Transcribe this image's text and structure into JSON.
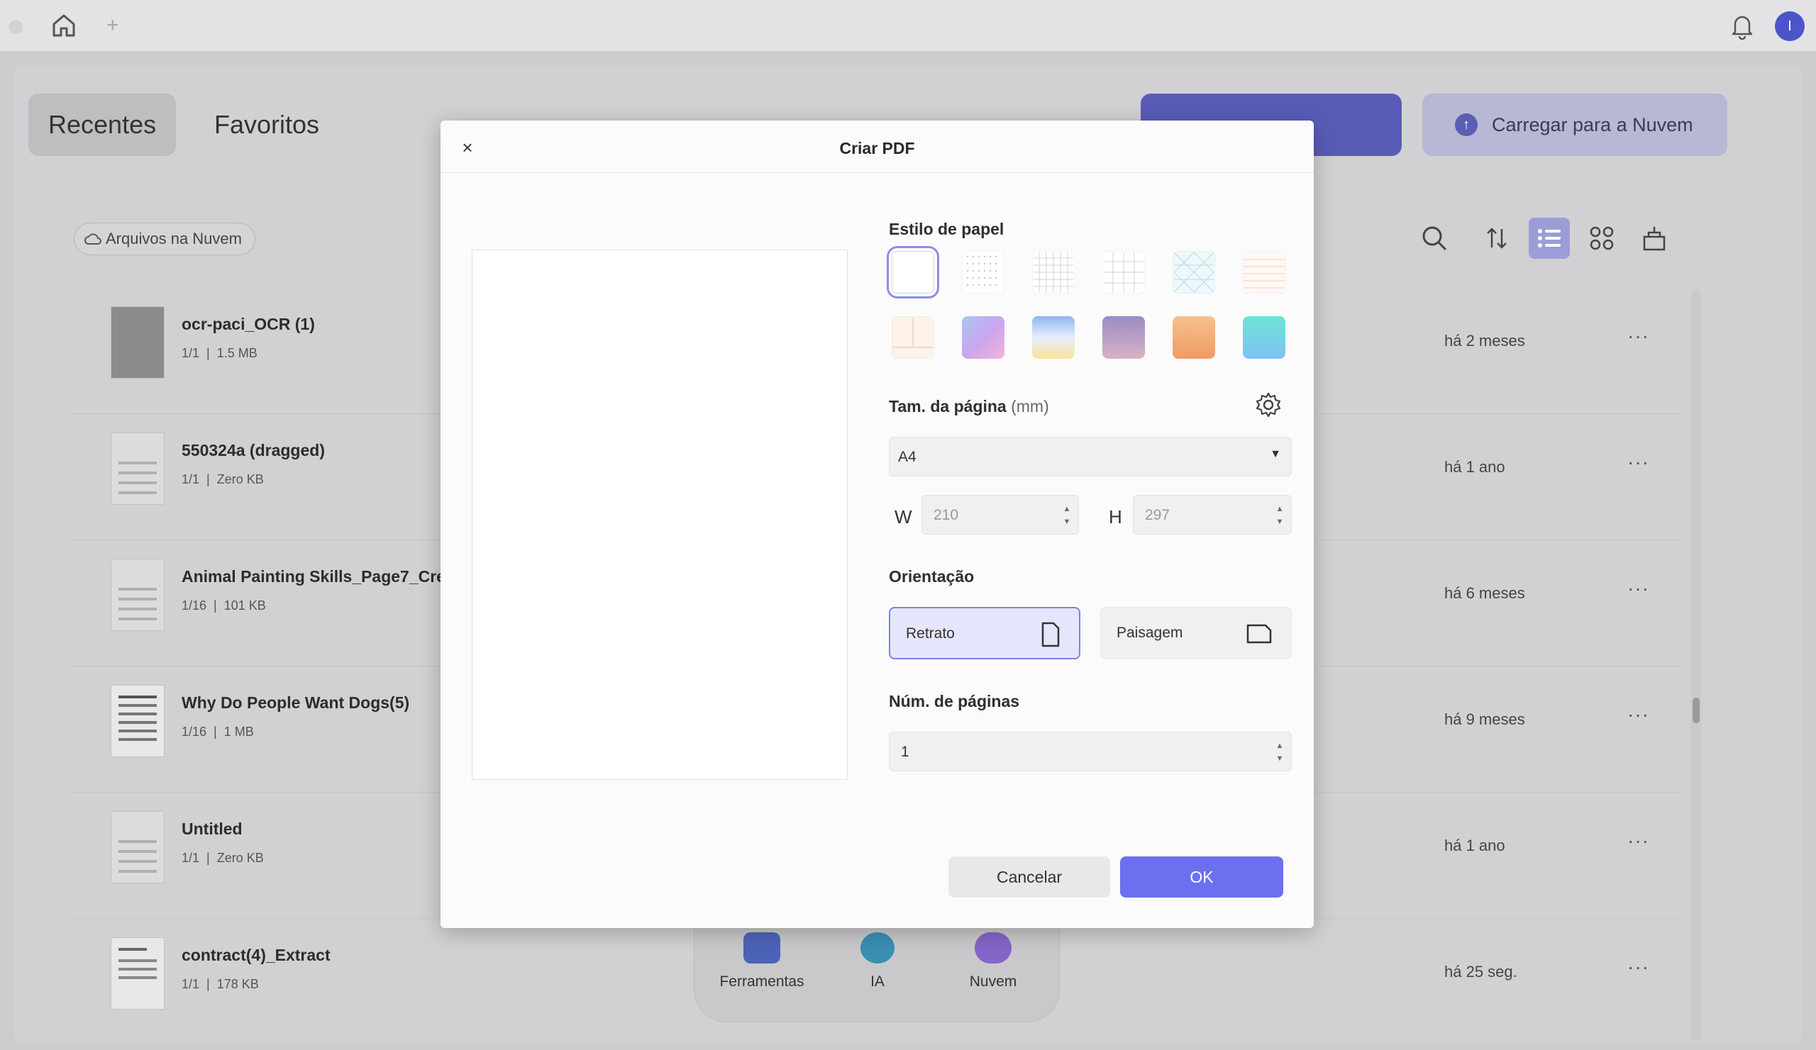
{
  "topbar": {
    "avatar_initial": "I"
  },
  "tabs": [
    {
      "label": "Recentes"
    },
    {
      "label": "Favoritos"
    }
  ],
  "header_buttons": {
    "upload_label": "Carregar para a Nuvem"
  },
  "cloud_filter": {
    "label": "Arquivos na Nuvem"
  },
  "files": [
    {
      "name": "ocr-paci_OCR (1)",
      "pages": "1/1",
      "size": "1.5 MB",
      "time": "há 2 meses"
    },
    {
      "name": "550324a (dragged)",
      "pages": "1/1",
      "size": "Zero KB",
      "time": "há 1 ano"
    },
    {
      "name": "Animal Painting Skills_Page7_Crea",
      "pages": "1/16",
      "size": "101 KB",
      "time": "há 6 meses"
    },
    {
      "name": "Why Do People Want Dogs(5)",
      "pages": "1/16",
      "size": "1 MB",
      "time": "há 9 meses"
    },
    {
      "name": "Untitled",
      "pages": "1/1",
      "size": "Zero KB",
      "time": "há 1 ano"
    },
    {
      "name": "contract(4)_Extract",
      "pages": "1/1",
      "size": "178 KB",
      "time": "há 25 seg."
    }
  ],
  "dock": [
    {
      "label": "Ferramentas"
    },
    {
      "label": "IA"
    },
    {
      "label": "Nuvem"
    }
  ],
  "modal": {
    "title": "Criar PDF",
    "paper_style_label": "Estilo de papel",
    "page_size_label": "Tam. da página",
    "page_size_unit": "(mm)",
    "page_size_value": "A4",
    "width_label": "W",
    "width_value": "210",
    "height_label": "H",
    "height_value": "297",
    "orientation_label": "Orientação",
    "orientation_portrait": "Retrato",
    "orientation_landscape": "Paisagem",
    "orientation_selected": "Retrato",
    "num_pages_label": "Núm. de páginas",
    "num_pages_value": "1",
    "cancel_label": "Cancelar",
    "ok_label": "OK"
  },
  "colors": {
    "accent": "#6c70ef",
    "accent_light": "#e5e6fb"
  }
}
